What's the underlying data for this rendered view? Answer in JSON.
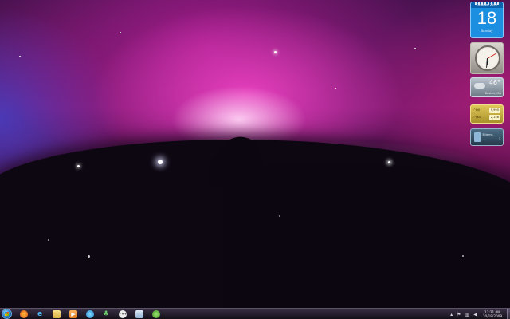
{
  "gadgets": {
    "calendar": {
      "month_year": "October, 2009",
      "day": "18",
      "weekday": "Sunday"
    },
    "clock": {},
    "weather": {
      "temperature": "46°",
      "city": "Boston, MA"
    },
    "stocks": {
      "rows": [
        {
          "symbol": "^DJI",
          "value": "9,995"
        },
        {
          "symbol": "^IXIC",
          "value": "2,156"
        }
      ]
    },
    "feed": {
      "text": "3 Items"
    }
  },
  "taskbar": {
    "pinned": [
      "firefox-icon",
      "internet-explorer-icon",
      "folder-icon",
      "media-player-icon",
      "messenger-icon",
      "contacts-icon",
      "chat-icon",
      "window-icon",
      "sync-icon"
    ],
    "tray": {
      "time": "12:21 PM",
      "date": "10/18/2009",
      "chevron": "▴"
    }
  },
  "colors": {
    "taskbar_bg": "#1e1a24",
    "calendar_bg": "#1d8fe0",
    "stocks_bg": "#c9ad3e"
  }
}
